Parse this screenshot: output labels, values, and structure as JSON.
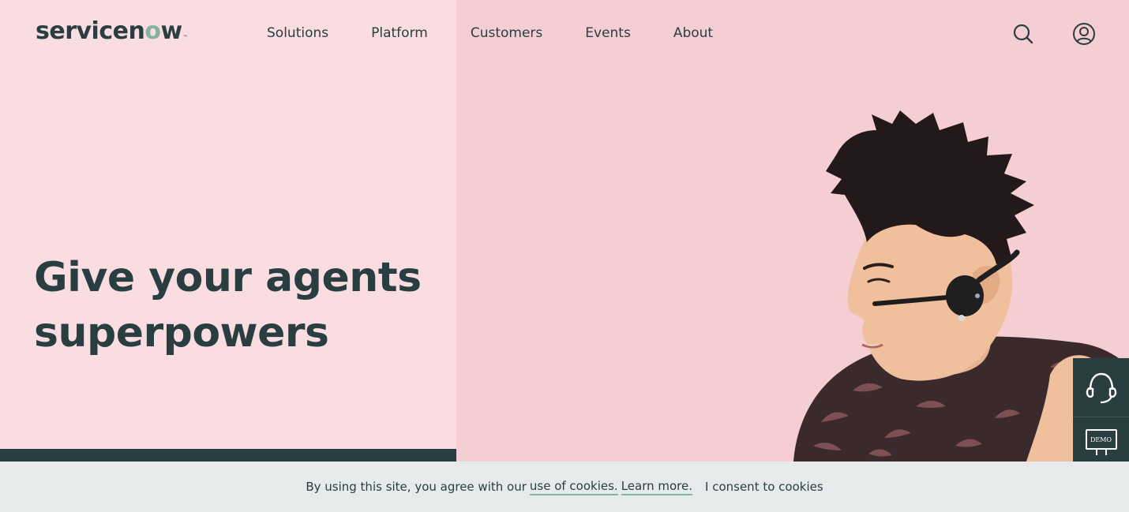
{
  "header": {
    "logo": {
      "main": "servicen",
      "accent_o": "o",
      "end": "w",
      "tm": "™"
    },
    "nav": [
      "Solutions",
      "Platform",
      "Customers",
      "Events",
      "About"
    ],
    "icons": {
      "search": "search-icon",
      "account": "user-account-icon"
    }
  },
  "hero": {
    "title": "Give your agents superpowers"
  },
  "side_widget": {
    "support_icon": "headset-icon",
    "demo_label": "DEMO"
  },
  "cookie_bar": {
    "text": "By using this site, you agree with our",
    "link_cookies": "use of cookies.",
    "link_learn": "Learn more.",
    "consent": "I consent to cookies"
  },
  "colors": {
    "brand_dark": "#293e40",
    "brand_green": "#81b5a1",
    "bg_left": "#f9dde0",
    "bg_right": "#f5ced4",
    "cookie_bg": "#e6eaea"
  }
}
